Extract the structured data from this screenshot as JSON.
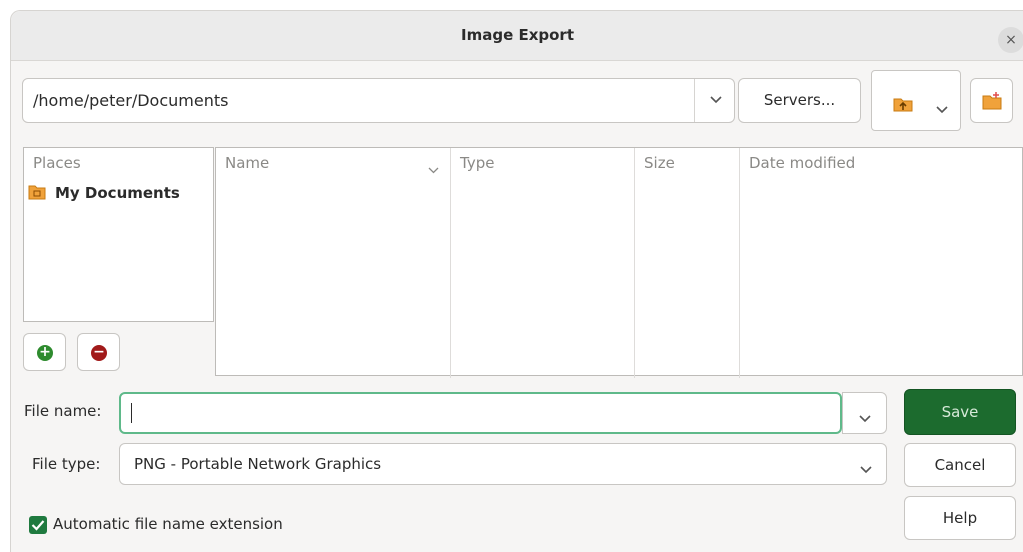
{
  "window": {
    "title": "Image Export",
    "close_glyph": "×"
  },
  "location": {
    "path": "/home/peter/Documents",
    "servers_label": "Servers..."
  },
  "places": {
    "header": "Places",
    "items": [
      {
        "label": "My Documents",
        "icon": "folder-documents-icon"
      }
    ],
    "add_glyph": "+",
    "remove_glyph": "−"
  },
  "file_list": {
    "columns": {
      "name": "Name",
      "type": "Type",
      "size": "Size",
      "date": "Date modified"
    }
  },
  "form": {
    "file_name_label": "File name:",
    "file_name_value": "",
    "file_type_label": "File type:",
    "file_type_value": "PNG - Portable Network Graphics",
    "auto_extension_label": "Automatic file name extension",
    "auto_extension_checked": true
  },
  "buttons": {
    "save": "Save",
    "cancel": "Cancel",
    "help": "Help"
  },
  "colors": {
    "save_bg": "#1c6b2e",
    "focus_border": "#5fb98a",
    "folder": "#f0a23b",
    "add": "#2e8b2e",
    "remove": "#a11a1a"
  }
}
